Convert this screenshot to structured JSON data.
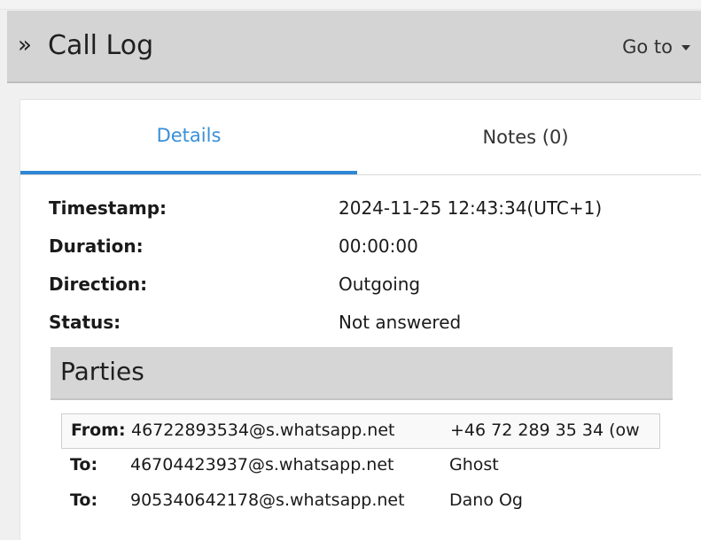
{
  "header": {
    "title": "Call Log",
    "goto_label": "Go to"
  },
  "tabs": [
    {
      "label": "Details",
      "active": true
    },
    {
      "label": "Notes (0)",
      "active": false
    }
  ],
  "details": [
    {
      "label": "Timestamp:",
      "value": "2024-11-25 12:43:34(UTC+1)"
    },
    {
      "label": "Duration:",
      "value": "00:00:00"
    },
    {
      "label": "Direction:",
      "value": "Outgoing"
    },
    {
      "label": "Status:",
      "value": "Not answered"
    }
  ],
  "parties": {
    "title": "Parties",
    "rows": [
      {
        "role": "From:",
        "id": "46722893534@s.whatsapp.net",
        "name": "+46 72 289 35 34 (ow",
        "selected": true
      },
      {
        "role": "To:",
        "id": "46704423937@s.whatsapp.net",
        "name": "Ghost",
        "selected": false
      },
      {
        "role": "To:",
        "id": "905340642178@s.whatsapp.net",
        "name": "Dano Og",
        "selected": false
      }
    ]
  },
  "colors": {
    "accent": "#2f86d4",
    "header_bg": "#d4d4d4"
  },
  "icons": {
    "header_chevron": "double-chevron-right-icon",
    "goto_caret": "caret-down-icon"
  }
}
